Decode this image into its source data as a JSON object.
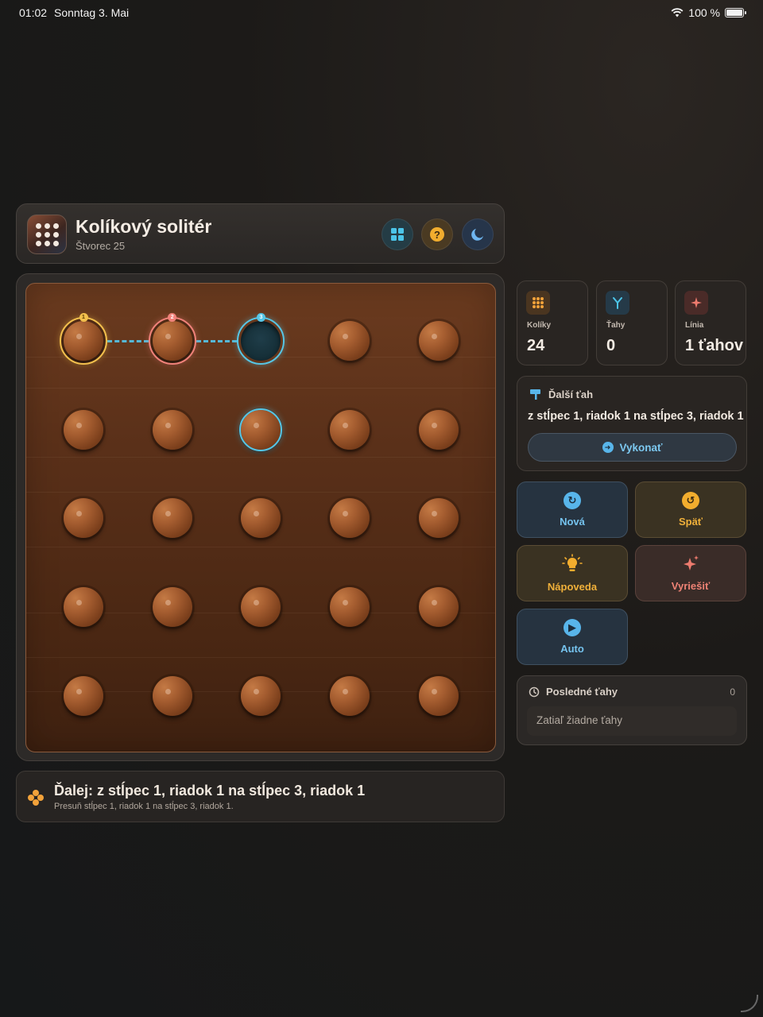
{
  "status_bar": {
    "time": "01:02",
    "date": "Sonntag 3. Mai",
    "battery": "100 %",
    "battery_fraction": 1.0
  },
  "header": {
    "title": "Kolíkový solitér",
    "subtitle": "Štvorec 25",
    "buttons": [
      "grid-icon",
      "help-icon",
      "moon-icon"
    ]
  },
  "board": {
    "rows": 5,
    "cols": 5,
    "cells": [
      [
        "peg-selected-1",
        "peg-selected-2",
        "empty-target-3",
        "peg",
        "peg"
      ],
      [
        "peg",
        "peg",
        "peg-jumped",
        "peg",
        "peg"
      ],
      [
        "peg",
        "peg",
        "peg",
        "peg",
        "peg"
      ],
      [
        "peg",
        "peg",
        "peg",
        "peg",
        "peg"
      ],
      [
        "peg",
        "peg",
        "peg",
        "peg",
        "peg"
      ]
    ],
    "path_badges": [
      "1",
      "2",
      "3"
    ],
    "colors": {
      "step1": "#f3c04d",
      "step2": "#f0827a",
      "step3": "#56c6e6",
      "wood": "#5a3019"
    }
  },
  "hint": {
    "title": "Ďalej: z stĺpec 1, riadok 1 na stĺpec 3, riadok 1",
    "subtitle": "Presuň stĺpec 1, riadok 1 na stĺpec 3, riadok 1."
  },
  "stats": {
    "pegs": {
      "label": "Kolíky",
      "value": "24",
      "icon": "pegs-icon"
    },
    "moves": {
      "label": "Ťahy",
      "value": "0",
      "icon": "branch-icon"
    },
    "line": {
      "label": "Línia",
      "value": "1 ťahov",
      "icon": "sparkle-icon"
    }
  },
  "next_move": {
    "label": "Ďalší ťah",
    "text": "z stĺpec 1, riadok 1 na stĺpec 3, riadok 1",
    "execute_label": "Vykonať"
  },
  "actions": {
    "new_label": "Nová",
    "undo_label": "Späť",
    "hint_label": "Nápoveda",
    "solve_label": "Vyriešiť",
    "auto_label": "Auto"
  },
  "recent": {
    "label": "Posledné ťahy",
    "count": "0",
    "empty_text": "Zatiaľ žiadne ťahy"
  }
}
